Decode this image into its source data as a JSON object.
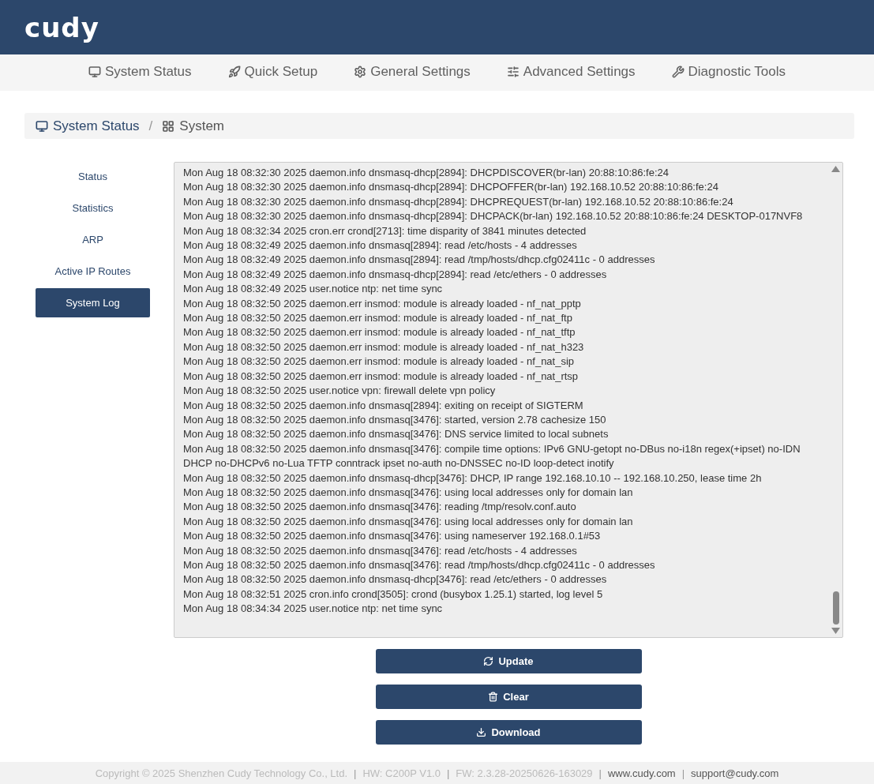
{
  "header": {
    "logo": "cudy"
  },
  "nav": [
    {
      "label": "System Status"
    },
    {
      "label": "Quick Setup"
    },
    {
      "label": "General Settings"
    },
    {
      "label": "Advanced Settings"
    },
    {
      "label": "Diagnostic Tools"
    }
  ],
  "breadcrumb": {
    "items": [
      {
        "label": "System Status"
      },
      {
        "label": "System"
      }
    ],
    "separator": "/"
  },
  "sidebar": {
    "items": [
      {
        "label": "Status",
        "selected": false
      },
      {
        "label": "Statistics",
        "selected": false
      },
      {
        "label": "ARP",
        "selected": false
      },
      {
        "label": "Active IP Routes",
        "selected": false
      },
      {
        "label": "System Log",
        "selected": true
      }
    ]
  },
  "log": {
    "lines": [
      "Mon Aug 18 08:32:30 2025 daemon.info dnsmasq-dhcp[2894]: DHCPDISCOVER(br-lan) 20:88:10:86:fe:24",
      "Mon Aug 18 08:32:30 2025 daemon.info dnsmasq-dhcp[2894]: DHCPOFFER(br-lan) 192.168.10.52 20:88:10:86:fe:24",
      "Mon Aug 18 08:32:30 2025 daemon.info dnsmasq-dhcp[2894]: DHCPREQUEST(br-lan) 192.168.10.52 20:88:10:86:fe:24",
      "Mon Aug 18 08:32:30 2025 daemon.info dnsmasq-dhcp[2894]: DHCPACK(br-lan) 192.168.10.52 20:88:10:86:fe:24 DESKTOP-017NVF8",
      "Mon Aug 18 08:32:34 2025 cron.err crond[2713]: time disparity of 3841 minutes detected",
      "Mon Aug 18 08:32:49 2025 daemon.info dnsmasq[2894]: read /etc/hosts - 4 addresses",
      "Mon Aug 18 08:32:49 2025 daemon.info dnsmasq[2894]: read /tmp/hosts/dhcp.cfg02411c - 0 addresses",
      "Mon Aug 18 08:32:49 2025 daemon.info dnsmasq-dhcp[2894]: read /etc/ethers - 0 addresses",
      "Mon Aug 18 08:32:49 2025 user.notice ntp: net time sync",
      "Mon Aug 18 08:32:50 2025 daemon.err insmod: module is already loaded - nf_nat_pptp",
      "Mon Aug 18 08:32:50 2025 daemon.err insmod: module is already loaded - nf_nat_ftp",
      "Mon Aug 18 08:32:50 2025 daemon.err insmod: module is already loaded - nf_nat_tftp",
      "Mon Aug 18 08:32:50 2025 daemon.err insmod: module is already loaded - nf_nat_h323",
      "Mon Aug 18 08:32:50 2025 daemon.err insmod: module is already loaded - nf_nat_sip",
      "Mon Aug 18 08:32:50 2025 daemon.err insmod: module is already loaded - nf_nat_rtsp",
      "Mon Aug 18 08:32:50 2025 user.notice vpn: firewall delete vpn policy",
      "Mon Aug 18 08:32:50 2025 daemon.info dnsmasq[2894]: exiting on receipt of SIGTERM",
      "Mon Aug 18 08:32:50 2025 daemon.info dnsmasq[3476]: started, version 2.78 cachesize 150",
      "Mon Aug 18 08:32:50 2025 daemon.info dnsmasq[3476]: DNS service limited to local subnets",
      "Mon Aug 18 08:32:50 2025 daemon.info dnsmasq[3476]: compile time options: IPv6 GNU-getopt no-DBus no-i18n regex(+ipset) no-IDN DHCP no-DHCPv6 no-Lua TFTP conntrack ipset no-auth no-DNSSEC no-ID loop-detect inotify",
      "Mon Aug 18 08:32:50 2025 daemon.info dnsmasq-dhcp[3476]: DHCP, IP range 192.168.10.10 -- 192.168.10.250, lease time 2h",
      "Mon Aug 18 08:32:50 2025 daemon.info dnsmasq[3476]: using local addresses only for domain lan",
      "Mon Aug 18 08:32:50 2025 daemon.info dnsmasq[3476]: reading /tmp/resolv.conf.auto",
      "Mon Aug 18 08:32:50 2025 daemon.info dnsmasq[3476]: using local addresses only for domain lan",
      "Mon Aug 18 08:32:50 2025 daemon.info dnsmasq[3476]: using nameserver 192.168.0.1#53",
      "Mon Aug 18 08:32:50 2025 daemon.info dnsmasq[3476]: read /etc/hosts - 4 addresses",
      "Mon Aug 18 08:32:50 2025 daemon.info dnsmasq[3476]: read /tmp/hosts/dhcp.cfg02411c - 0 addresses",
      "Mon Aug 18 08:32:50 2025 daemon.info dnsmasq-dhcp[3476]: read /etc/ethers - 0 addresses",
      "Mon Aug 18 08:32:51 2025 cron.info crond[3505]: crond (busybox 1.25.1) started, log level 5",
      "Mon Aug 18 08:34:34 2025 user.notice ntp: net time sync"
    ]
  },
  "buttons": [
    {
      "label": "Update"
    },
    {
      "label": "Clear"
    },
    {
      "label": "Download"
    }
  ],
  "footer": {
    "separator": "|",
    "items": [
      {
        "text": "Copyright © 2025 Shenzhen Cudy Technology Co., Ltd.",
        "kind": "text"
      },
      {
        "text": "HW: C200P V1.0",
        "kind": "text"
      },
      {
        "text": "FW: 2.3.28-20250626-163029",
        "kind": "text"
      },
      {
        "text": "www.cudy.com",
        "kind": "link"
      },
      {
        "text": "support@cudy.com",
        "kind": "link"
      }
    ]
  }
}
